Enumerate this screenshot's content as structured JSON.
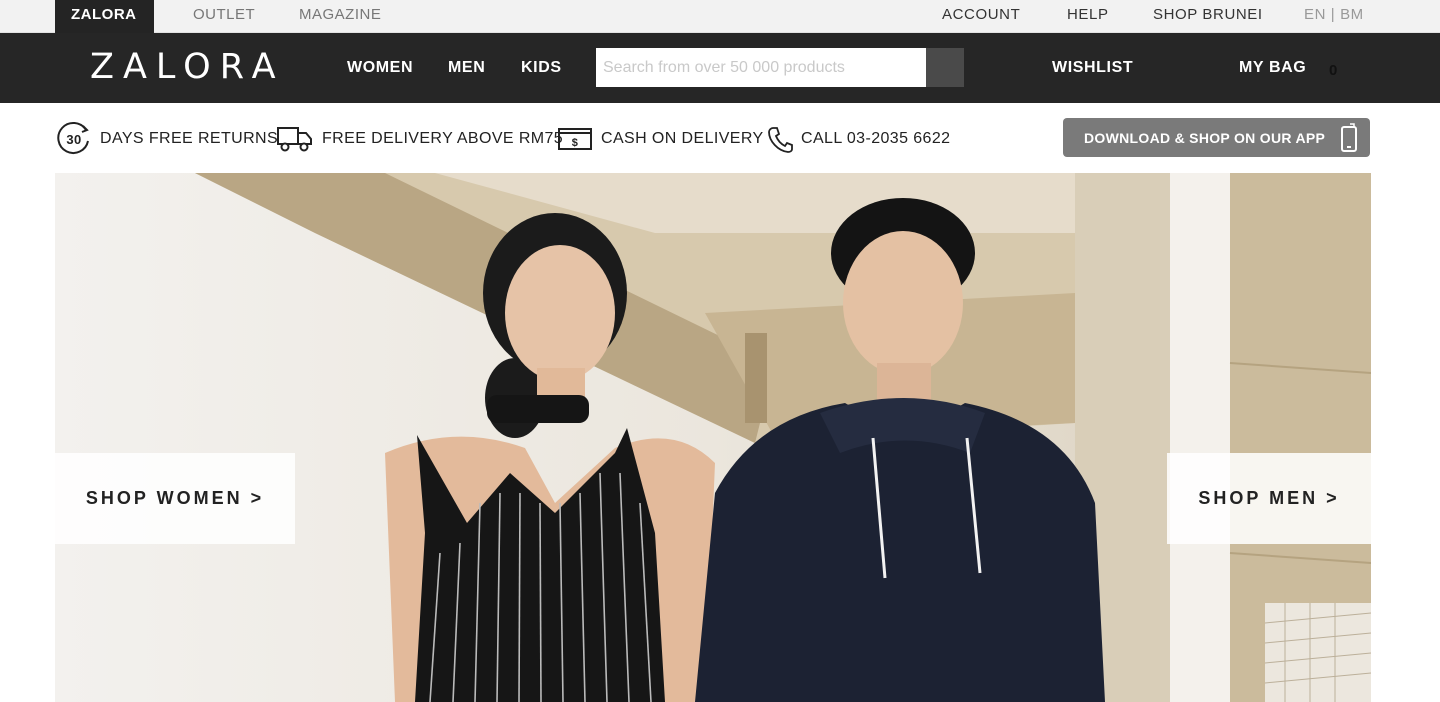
{
  "topbar": {
    "tabs": [
      "ZALORA",
      "OUTLET",
      "MAGAZINE"
    ],
    "links": [
      "ACCOUNT",
      "HELP",
      "SHOP BRUNEI",
      "EN | BM"
    ]
  },
  "navbar": {
    "logo": "ZALORA",
    "links": [
      "WOMEN",
      "MEN",
      "KIDS"
    ],
    "search_placeholder": "Search from over 50 000 products",
    "wishlist": "WISHLIST",
    "bag": "MY BAG",
    "bag_count": "0"
  },
  "usp": {
    "returns_days": "30",
    "returns": "DAYS FREE RETURNS",
    "delivery": "FREE DELIVERY ABOVE RM75",
    "cod": "CASH ON DELIVERY",
    "call": "CALL 03-2035 6622",
    "app": "DOWNLOAD & SHOP ON OUR APP"
  },
  "hero": {
    "shop_women": "SHOP WOMEN >",
    "shop_men": "SHOP MEN >"
  },
  "icons": [
    "returns-30-icon",
    "truck-icon",
    "cash-icon",
    "phone-call-icon",
    "mobile-phone-icon",
    "search-icon"
  ],
  "colors": {
    "nav_bg": "#262626",
    "topbar_bg": "#f2f2f2",
    "app_button": "#7a7a7a"
  }
}
